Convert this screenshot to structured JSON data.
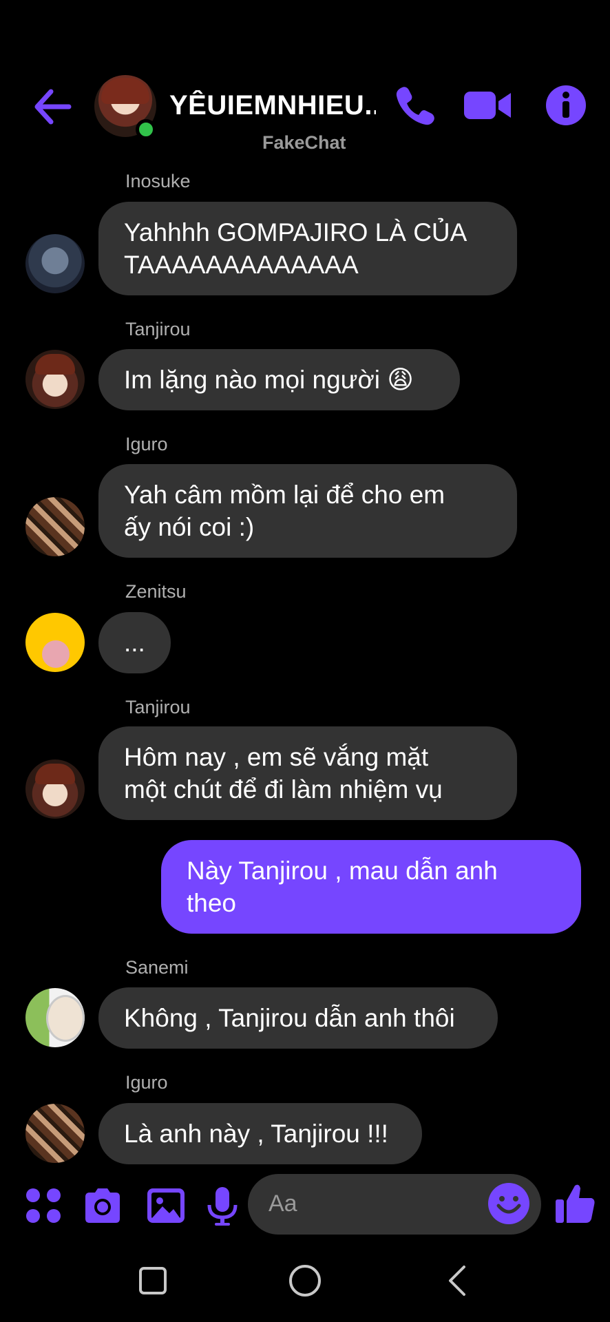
{
  "header": {
    "title": "YÊUIEMNHIEU...",
    "subtitle": "FakeChat"
  },
  "messages": [
    {
      "sender": "Inosuke",
      "text": "Yahhhh GOMPAJIRO LÀ CỦA\nTAAAAAAAAAAAAA"
    },
    {
      "sender": "Tanjirou",
      "text": "Im lặng nào mọi người 😩"
    },
    {
      "sender": "Iguro",
      "text": "Yah câm mồm lại để cho em\nấy nói coi :)"
    },
    {
      "sender": "Zenitsu",
      "text": "..."
    },
    {
      "sender": "Tanjirou",
      "text": "Hôm nay , em sẽ vắng mặt\nmột chút để đi làm nhiệm vụ"
    },
    {
      "sender": "",
      "text": "Này Tanjirou , mau dẫn anh\ntheo"
    },
    {
      "sender": "Sanemi",
      "text": "Không , Tanjirou dẫn anh thôi"
    },
    {
      "sender": "Iguro",
      "text": "Là anh này , Tanjirou !!!"
    }
  ],
  "composer": {
    "placeholder": "Aa"
  },
  "colors": {
    "accent": "#7646ff",
    "bubble": "#333333",
    "online": "#31c24a"
  }
}
